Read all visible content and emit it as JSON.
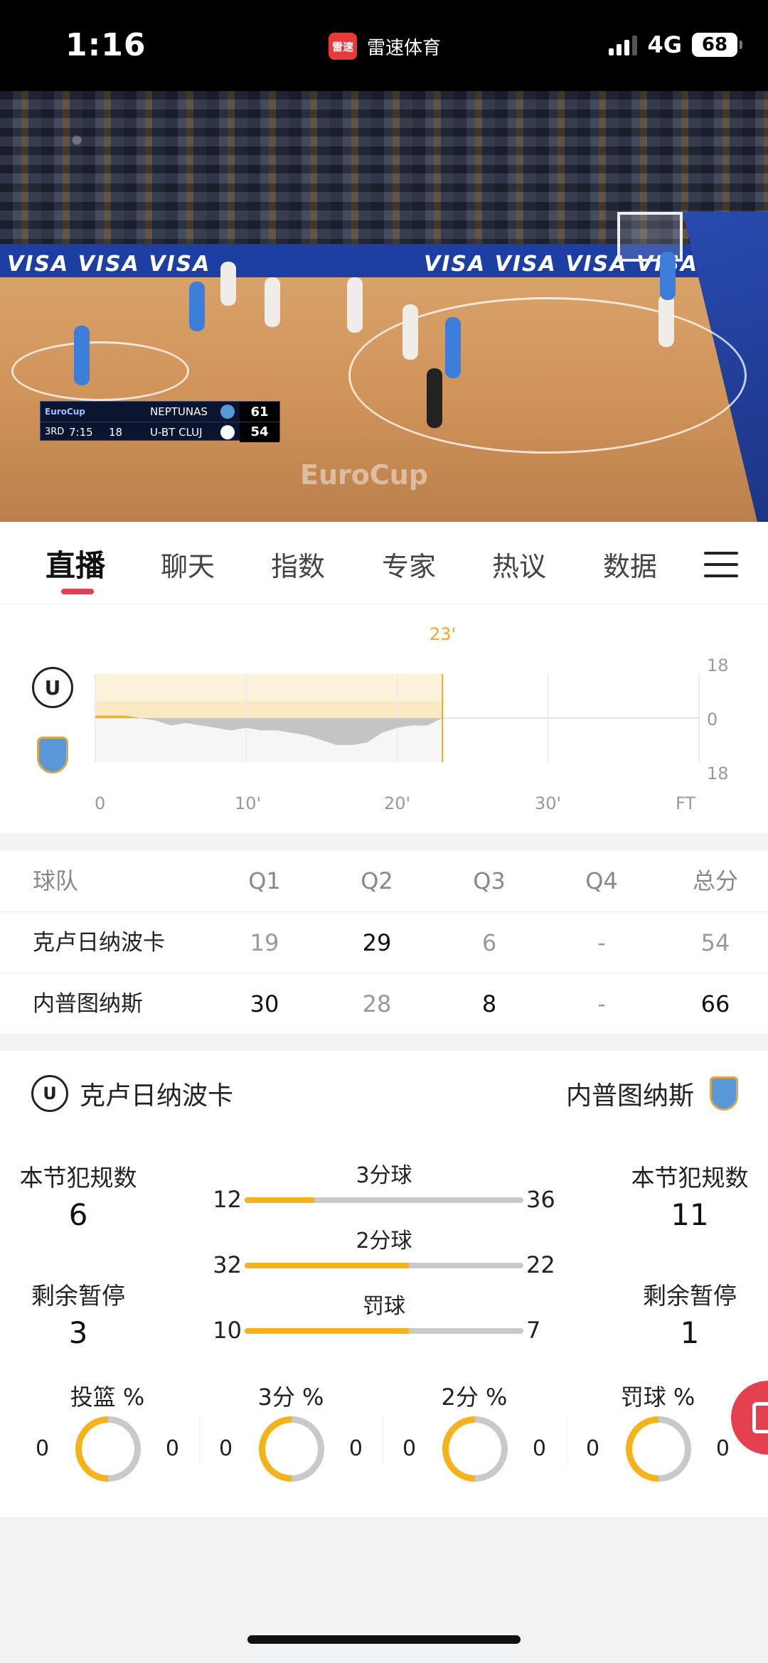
{
  "status_bar": {
    "time": "1:16",
    "app_badge": "雷速",
    "app_name": "雷速体育",
    "network": "4G",
    "battery": "68"
  },
  "video": {
    "scoreboard": {
      "league": "EuroCup",
      "quarter": "3RD",
      "clock": "7:15",
      "shot_clock": "18",
      "team1": "NEPTUNAS",
      "score1": "61",
      "team2": "U-BT CLUJ",
      "score2": "54"
    },
    "ads": [
      "VISA VISA VISA",
      "VISA VISA VISA VISA"
    ],
    "watermark": "EuroCup"
  },
  "tabs": {
    "items": [
      "直播",
      "聊天",
      "指数",
      "专家",
      "热议",
      "数据"
    ],
    "active": "直播"
  },
  "trend": {
    "current_time": "23'",
    "x_ticks": [
      "0",
      "10'",
      "20'",
      "30'",
      "FT"
    ],
    "y_ticks": [
      "18",
      "0",
      "18"
    ],
    "current_minute": 23,
    "series": {
      "minutes": [
        0,
        1,
        2,
        3,
        4,
        5,
        6,
        7,
        8,
        9,
        10,
        11,
        12,
        13,
        14,
        15,
        16,
        17,
        18,
        19,
        20,
        21,
        22,
        23
      ],
      "diff": [
        1,
        1,
        1,
        0,
        -1,
        -3,
        -2,
        -3,
        -4,
        -5,
        -4,
        -5,
        -5,
        -6,
        -7,
        -9,
        -11,
        -11,
        -10,
        -6,
        -4,
        -3,
        -3,
        0
      ]
    }
  },
  "quarters": {
    "headers": [
      "球队",
      "Q1",
      "Q2",
      "Q3",
      "Q4",
      "总分"
    ],
    "rows": [
      {
        "team": "克卢日纳波卡",
        "q": [
          "19",
          "29",
          "6",
          "-"
        ],
        "total": "54"
      },
      {
        "team": "内普图纳斯",
        "q": [
          "30",
          "28",
          "8",
          "-"
        ],
        "total": "66"
      }
    ]
  },
  "stats": {
    "team_left": "克卢日纳波卡",
    "team_right": "内普图纳斯",
    "left": {
      "fouls_label": "本节犯规数",
      "fouls": "6",
      "timeouts_label": "剩余暂停",
      "timeouts": "3"
    },
    "right": {
      "fouls_label": "本节犯规数",
      "fouls": "11",
      "timeouts_label": "剩余暂停",
      "timeouts": "1"
    },
    "bars": [
      {
        "label": "3分球",
        "left": "12",
        "right": "36",
        "left_share": 0.25
      },
      {
        "label": "2分球",
        "left": "32",
        "right": "22",
        "left_share": 0.59
      },
      {
        "label": "罚球",
        "left": "10",
        "right": "7",
        "left_share": 0.59
      }
    ],
    "percentages": [
      {
        "label": "投篮 %",
        "left": "0",
        "right": "0"
      },
      {
        "label": "3分 %",
        "left": "0",
        "right": "0"
      },
      {
        "label": "2分 %",
        "left": "0",
        "right": "0"
      },
      {
        "label": "罚球 %",
        "left": "0",
        "right": "0"
      }
    ]
  },
  "colors": {
    "accent": "#e5404f",
    "bar_fill": "#f5b21a",
    "trend_fill": "#c4c4c4",
    "current_line": "#f5a623"
  }
}
